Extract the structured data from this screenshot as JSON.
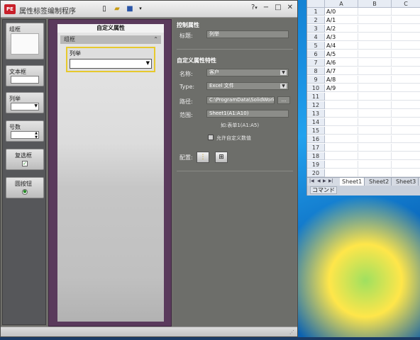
{
  "window": {
    "title": "属性标签编制程序",
    "app_icon": "PE",
    "toolbar_icons": [
      "new-file-icon",
      "open-folder-icon",
      "save-icon",
      "dropdown-icon"
    ],
    "controls": {
      "help": "?",
      "help_arrow": "▾",
      "minimize": "−",
      "maximize": "□",
      "close": "✕"
    }
  },
  "palette": {
    "items": [
      {
        "label": "组框"
      },
      {
        "label": "文本框"
      },
      {
        "label": "列举"
      },
      {
        "label": "号数"
      },
      {
        "label": "复选框"
      },
      {
        "label": "圆按钮"
      }
    ]
  },
  "center": {
    "title": "自定义属性",
    "group_label": "组框",
    "list_label": "列举"
  },
  "props": {
    "control_section": "控制属性",
    "caption_label": "标题:",
    "caption_value": "列举",
    "custom_section": "自定义属性特性",
    "name_label": "名称:",
    "name_value": "客户",
    "type_label": "Type:",
    "type_value": "Excel 文件",
    "path_label": "路径:",
    "path_value": "C:\\ProgramData\\SolidWorks\\",
    "browse_label": "...",
    "range_label": "范围:",
    "range_value": "Sheet1(A1:A10)",
    "range_hint": "如:表单1(A1:A5)",
    "allow_label": "允许自定义数值",
    "config_label": "配置:"
  },
  "excel": {
    "columns": [
      "A",
      "B",
      "C"
    ],
    "rows": [
      {
        "n": "1",
        "a": "A/0"
      },
      {
        "n": "2",
        "a": "A/1"
      },
      {
        "n": "3",
        "a": "A/2"
      },
      {
        "n": "4",
        "a": "A/3"
      },
      {
        "n": "5",
        "a": "A/4"
      },
      {
        "n": "6",
        "a": "A/5"
      },
      {
        "n": "7",
        "a": "A/6"
      },
      {
        "n": "8",
        "a": "A/7"
      },
      {
        "n": "9",
        "a": "A/8"
      },
      {
        "n": "10",
        "a": "A/9"
      },
      {
        "n": "11",
        "a": ""
      },
      {
        "n": "12",
        "a": ""
      },
      {
        "n": "13",
        "a": ""
      },
      {
        "n": "14",
        "a": ""
      },
      {
        "n": "15",
        "a": ""
      },
      {
        "n": "16",
        "a": ""
      },
      {
        "n": "17",
        "a": ""
      },
      {
        "n": "18",
        "a": ""
      },
      {
        "n": "19",
        "a": ""
      },
      {
        "n": "20",
        "a": ""
      }
    ],
    "sheets": [
      "Sheet1",
      "Sheet2",
      "Sheet3"
    ],
    "status": "コマンド"
  }
}
